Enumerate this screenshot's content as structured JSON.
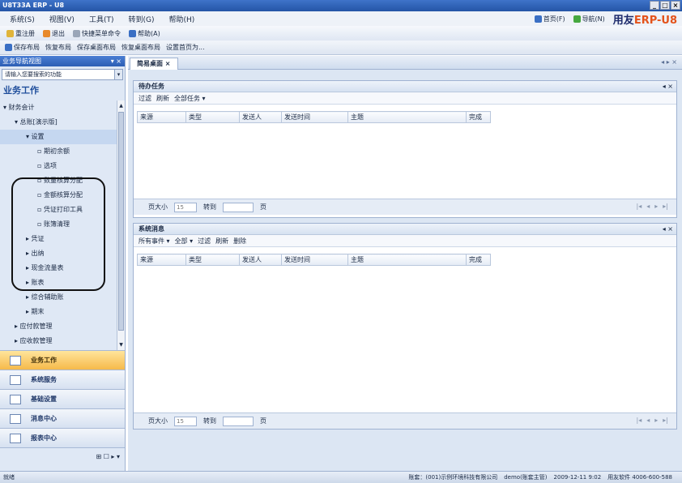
{
  "window": {
    "title": "U8T33A  ERP - U8",
    "min": "_",
    "max": "□",
    "close": "×"
  },
  "menu": {
    "items": [
      "系统(S)",
      "视图(V)",
      "工具(T)",
      "转到(G)",
      "帮助(H)"
    ],
    "right": {
      "home": "首页(F)",
      "nav": "导航(N)",
      "brand_a": "用友",
      "brand_b": "ERP-U8"
    }
  },
  "toolbar1": {
    "items": [
      "重注册",
      "退出",
      "快捷菜单命令",
      "帮助(A)"
    ]
  },
  "toolbar2": {
    "items": [
      "保存布局",
      "恢复布局",
      "保存桌面布局",
      "恢复桌面布局",
      "设置首页为..."
    ]
  },
  "sidebar": {
    "header": "业务导航视图",
    "header_ctrl": "▾ ×",
    "search_placeholder": "请输入您要搜索的功能",
    "title": "业务工作",
    "tree": [
      {
        "label": "▾ 财务会计",
        "indent": 4
      },
      {
        "label": "▾ 总账[演示版]",
        "indent": 18
      },
      {
        "label": "▾ 设置",
        "indent": 32,
        "sel": true
      },
      {
        "label": "期初余额",
        "indent": 46,
        "leaf": true
      },
      {
        "label": "选项",
        "indent": 46,
        "leaf": true
      },
      {
        "label": "数量核算分配",
        "indent": 46,
        "leaf": true
      },
      {
        "label": "金额核算分配",
        "indent": 46,
        "leaf": true
      },
      {
        "label": "凭证打印工具",
        "indent": 46,
        "leaf": true
      },
      {
        "label": "账簿清理",
        "indent": 46,
        "leaf": true
      },
      {
        "label": "▸ 凭证",
        "indent": 32
      },
      {
        "label": "▸ 出纳",
        "indent": 32
      },
      {
        "label": "▸ 现金流量表",
        "indent": 32
      },
      {
        "label": "▸ 账表",
        "indent": 32
      },
      {
        "label": "▸ 综合辅助账",
        "indent": 32
      },
      {
        "label": "▸ 期末",
        "indent": 32
      },
      {
        "label": "▸ 应付款管理",
        "indent": 18
      },
      {
        "label": "▸ 应收款管理",
        "indent": 18
      }
    ],
    "panels": [
      "业务工作",
      "系统服务",
      "基础设置",
      "消息中心",
      "报表中心"
    ],
    "bottom": "⊞ ☐ ▸ ▾"
  },
  "main": {
    "tab": "简易桌面 ×",
    "tab_ctrl": "◂ ▸ ×",
    "pane1": {
      "title": "待办任务",
      "close": "◂ ×",
      "tools": [
        "过滤",
        "刷新",
        "全部任务 ▾"
      ],
      "columns": [
        "来源",
        "类型",
        "发送人",
        "发送时间",
        "主题",
        "完成"
      ],
      "page_label": "页大小",
      "page_size": "15",
      "page_mid": "转到",
      "page_unit": "页",
      "nav": [
        "|◂",
        "◂",
        "▸",
        "▸|"
      ]
    },
    "pane2": {
      "title": "系统消息",
      "close": "◂ ×",
      "tools": [
        "所有事件 ▾",
        "全部 ▾",
        "过滤",
        "刷新",
        "删除"
      ],
      "columns": [
        "来源",
        "类型",
        "发送人",
        "发送时间",
        "主题",
        "完成"
      ],
      "page_label": "页大小",
      "page_size": "15",
      "page_mid": "转到",
      "page_unit": "页",
      "nav": [
        "|◂",
        "◂",
        "▸",
        "▸|"
      ]
    }
  },
  "status": {
    "left": "就绪",
    "items": [
      "账套：(001)示例环境科技有限公司",
      "demo(账套主管)",
      "2009-12-11 9:02",
      "用友软件 4006-600-588"
    ]
  }
}
